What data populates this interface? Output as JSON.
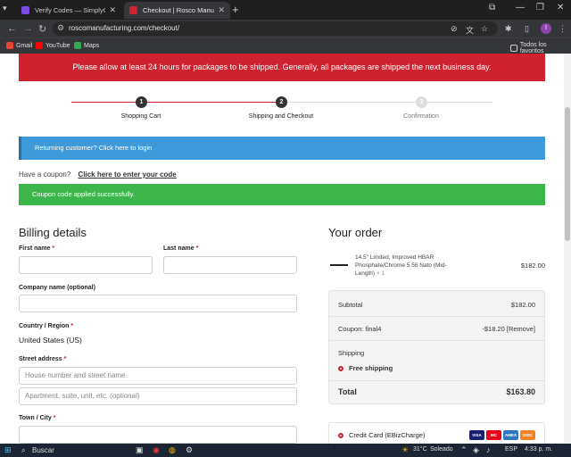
{
  "browser": {
    "tabs": [
      {
        "title": "Verify Codes — SimplyCodes",
        "favicon_color": "#7b4ce0",
        "active": false
      },
      {
        "title": "Checkout | Rosco Manufacturin",
        "favicon_color": "#d0222e",
        "active": true
      }
    ],
    "url": "roscomanufacturing.com/checkout/",
    "profile_initial": "I",
    "bookmarks": [
      {
        "label": "Gmail",
        "color": "#ea4335"
      },
      {
        "label": "YouTube",
        "color": "#ff0000"
      },
      {
        "label": "Maps",
        "color": "#34a853"
      }
    ],
    "all_bookmarks_label": "Todos los favoritos"
  },
  "banner": {
    "text": "Please allow at least 24 hours for packages to be shipped. Generally, all packages are shipped the next business day."
  },
  "steps": [
    {
      "number": "1",
      "label": "Shopping Cart",
      "state": "done"
    },
    {
      "number": "2",
      "label": "Shipping and Checkout",
      "state": "current"
    },
    {
      "number": "3",
      "label": "Confirmation",
      "state": "pending"
    }
  ],
  "notices": {
    "returning": "Returning customer? Click here to login",
    "coupon_prompt": "Have a coupon?",
    "coupon_link": "Click here to enter your code",
    "coupon_success": "Coupon code applied successfully."
  },
  "billing": {
    "title": "Billing details",
    "first_name_label": "First name",
    "last_name_label": "Last name",
    "company_label": "Company name (optional)",
    "country_label": "Country / Region",
    "country_value": "United States (US)",
    "street_label": "Street address",
    "street_placeholder": "House number and street name",
    "apt_placeholder": "Apartment, suite, unit, etc. (optional)",
    "city_label": "Town / City",
    "required_mark": "*"
  },
  "order": {
    "title": "Your order",
    "item_name": "14.5\" Limited, Improved HBAR Phosphate/Chrome 5.56 Nato (Mid-Length)",
    "item_qty": "× 1",
    "item_price": "$182.00",
    "subtotal_label": "Subtotal",
    "subtotal_value": "$182.00",
    "coupon_label": "Coupon: final4",
    "coupon_value": "-$18.20",
    "coupon_remove": "[Remove]",
    "shipping_label": "Shipping",
    "shipping_option": "Free shipping",
    "total_label": "Total",
    "total_value": "$163.80",
    "payment_method": "Credit Card (EBizCharge)",
    "cards": [
      "VISA",
      "MC",
      "AMEX",
      "DISC"
    ]
  },
  "taskbar": {
    "search_label": "Buscar",
    "weather": "31°C",
    "weather_desc": "Soleado",
    "lang": "ESP",
    "time": "4:33 p. m."
  }
}
